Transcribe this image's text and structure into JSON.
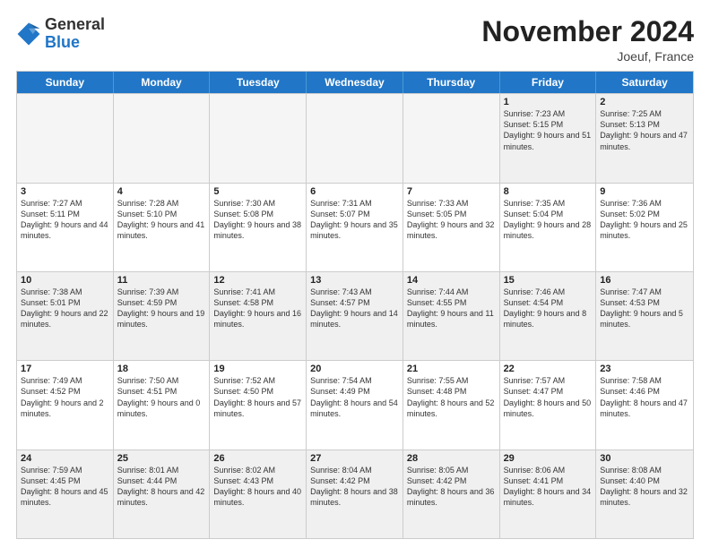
{
  "logo": {
    "general": "General",
    "blue": "Blue"
  },
  "title": "November 2024",
  "location": "Joeuf, France",
  "days_of_week": [
    "Sunday",
    "Monday",
    "Tuesday",
    "Wednesday",
    "Thursday",
    "Friday",
    "Saturday"
  ],
  "weeks": [
    [
      {
        "day": "",
        "empty": true
      },
      {
        "day": "",
        "empty": true
      },
      {
        "day": "",
        "empty": true
      },
      {
        "day": "",
        "empty": true
      },
      {
        "day": "",
        "empty": true
      },
      {
        "day": "1",
        "sunrise": "7:23 AM",
        "sunset": "5:15 PM",
        "daylight": "9 hours and 51 minutes."
      },
      {
        "day": "2",
        "sunrise": "7:25 AM",
        "sunset": "5:13 PM",
        "daylight": "9 hours and 47 minutes."
      }
    ],
    [
      {
        "day": "3",
        "sunrise": "7:27 AM",
        "sunset": "5:11 PM",
        "daylight": "9 hours and 44 minutes."
      },
      {
        "day": "4",
        "sunrise": "7:28 AM",
        "sunset": "5:10 PM",
        "daylight": "9 hours and 41 minutes."
      },
      {
        "day": "5",
        "sunrise": "7:30 AM",
        "sunset": "5:08 PM",
        "daylight": "9 hours and 38 minutes."
      },
      {
        "day": "6",
        "sunrise": "7:31 AM",
        "sunset": "5:07 PM",
        "daylight": "9 hours and 35 minutes."
      },
      {
        "day": "7",
        "sunrise": "7:33 AM",
        "sunset": "5:05 PM",
        "daylight": "9 hours and 32 minutes."
      },
      {
        "day": "8",
        "sunrise": "7:35 AM",
        "sunset": "5:04 PM",
        "daylight": "9 hours and 28 minutes."
      },
      {
        "day": "9",
        "sunrise": "7:36 AM",
        "sunset": "5:02 PM",
        "daylight": "9 hours and 25 minutes."
      }
    ],
    [
      {
        "day": "10",
        "sunrise": "7:38 AM",
        "sunset": "5:01 PM",
        "daylight": "9 hours and 22 minutes."
      },
      {
        "day": "11",
        "sunrise": "7:39 AM",
        "sunset": "4:59 PM",
        "daylight": "9 hours and 19 minutes."
      },
      {
        "day": "12",
        "sunrise": "7:41 AM",
        "sunset": "4:58 PM",
        "daylight": "9 hours and 16 minutes."
      },
      {
        "day": "13",
        "sunrise": "7:43 AM",
        "sunset": "4:57 PM",
        "daylight": "9 hours and 14 minutes."
      },
      {
        "day": "14",
        "sunrise": "7:44 AM",
        "sunset": "4:55 PM",
        "daylight": "9 hours and 11 minutes."
      },
      {
        "day": "15",
        "sunrise": "7:46 AM",
        "sunset": "4:54 PM",
        "daylight": "9 hours and 8 minutes."
      },
      {
        "day": "16",
        "sunrise": "7:47 AM",
        "sunset": "4:53 PM",
        "daylight": "9 hours and 5 minutes."
      }
    ],
    [
      {
        "day": "17",
        "sunrise": "7:49 AM",
        "sunset": "4:52 PM",
        "daylight": "9 hours and 2 minutes."
      },
      {
        "day": "18",
        "sunrise": "7:50 AM",
        "sunset": "4:51 PM",
        "daylight": "9 hours and 0 minutes."
      },
      {
        "day": "19",
        "sunrise": "7:52 AM",
        "sunset": "4:50 PM",
        "daylight": "8 hours and 57 minutes."
      },
      {
        "day": "20",
        "sunrise": "7:54 AM",
        "sunset": "4:49 PM",
        "daylight": "8 hours and 54 minutes."
      },
      {
        "day": "21",
        "sunrise": "7:55 AM",
        "sunset": "4:48 PM",
        "daylight": "8 hours and 52 minutes."
      },
      {
        "day": "22",
        "sunrise": "7:57 AM",
        "sunset": "4:47 PM",
        "daylight": "8 hours and 50 minutes."
      },
      {
        "day": "23",
        "sunrise": "7:58 AM",
        "sunset": "4:46 PM",
        "daylight": "8 hours and 47 minutes."
      }
    ],
    [
      {
        "day": "24",
        "sunrise": "7:59 AM",
        "sunset": "4:45 PM",
        "daylight": "8 hours and 45 minutes."
      },
      {
        "day": "25",
        "sunrise": "8:01 AM",
        "sunset": "4:44 PM",
        "daylight": "8 hours and 42 minutes."
      },
      {
        "day": "26",
        "sunrise": "8:02 AM",
        "sunset": "4:43 PM",
        "daylight": "8 hours and 40 minutes."
      },
      {
        "day": "27",
        "sunrise": "8:04 AM",
        "sunset": "4:42 PM",
        "daylight": "8 hours and 38 minutes."
      },
      {
        "day": "28",
        "sunrise": "8:05 AM",
        "sunset": "4:42 PM",
        "daylight": "8 hours and 36 minutes."
      },
      {
        "day": "29",
        "sunrise": "8:06 AM",
        "sunset": "4:41 PM",
        "daylight": "8 hours and 34 minutes."
      },
      {
        "day": "30",
        "sunrise": "8:08 AM",
        "sunset": "4:40 PM",
        "daylight": "8 hours and 32 minutes."
      }
    ]
  ]
}
